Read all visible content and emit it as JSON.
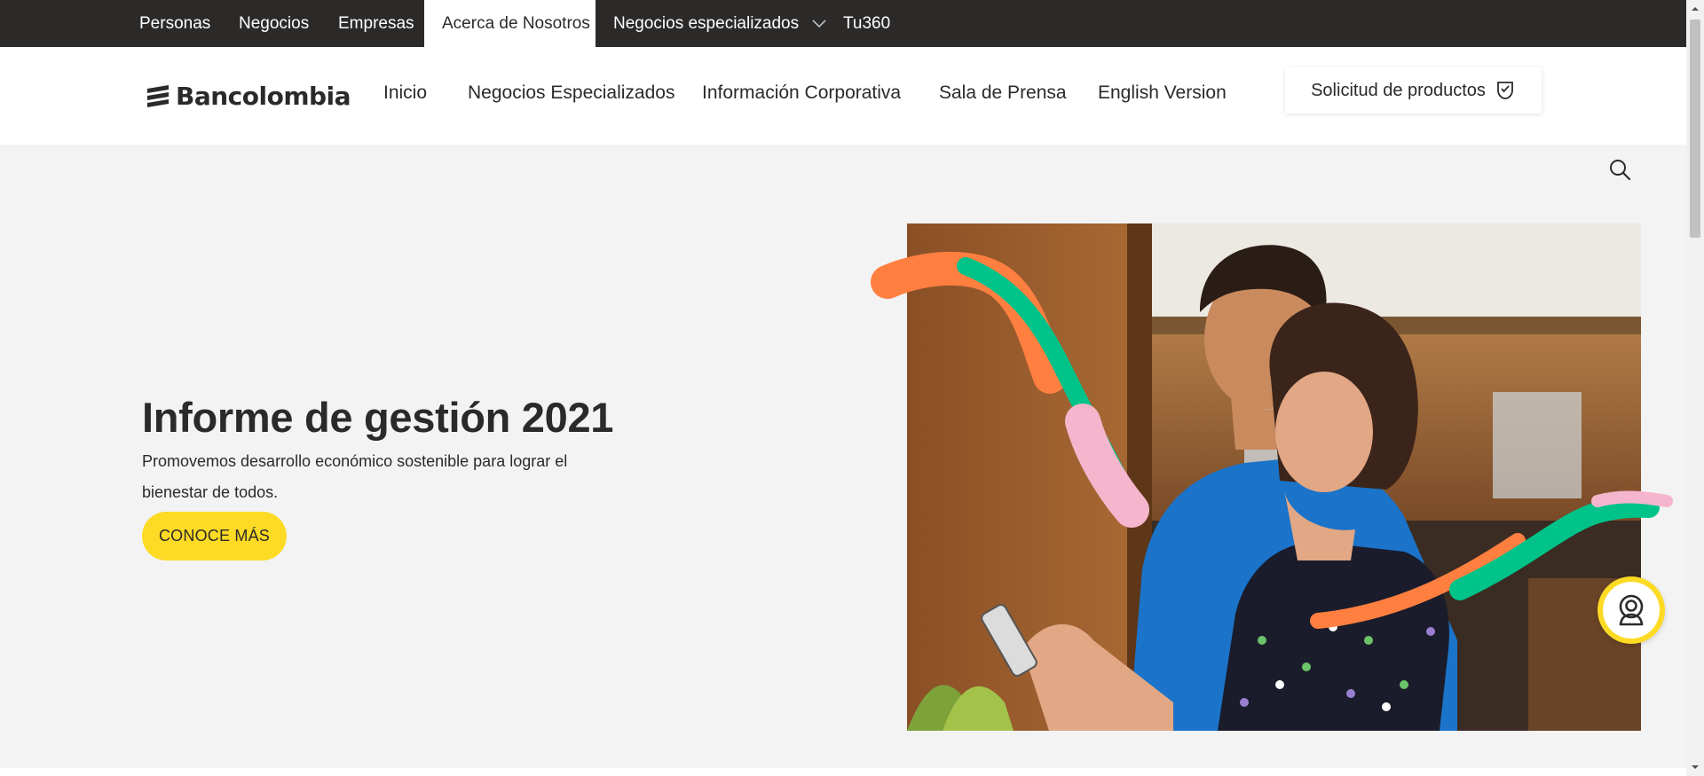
{
  "topbar": {
    "tabs": [
      {
        "label": "Personas"
      },
      {
        "label": "Negocios"
      },
      {
        "label": "Empresas"
      },
      {
        "label": "Acerca de Nosotros",
        "active": true
      },
      {
        "label": "Negocios especializados",
        "has_dropdown": true
      },
      {
        "label": "Tu360"
      }
    ]
  },
  "header": {
    "logo_text": "Bancolombia",
    "nav": [
      {
        "label": "Inicio"
      },
      {
        "label": "Negocios Especializados"
      },
      {
        "label": "Información Corporativa"
      },
      {
        "label": "Sala de Prensa"
      },
      {
        "label": "English Version"
      }
    ],
    "products_button": "Solicitud de productos"
  },
  "hero": {
    "title": "Informe de gestión 2021",
    "subtitle": "Promovemos desarrollo económico sostenible para lograr el bienestar de todos.",
    "cta": "CONOCE MÁS"
  },
  "colors": {
    "dark": "#2c2a29",
    "yellow": "#fdda24",
    "orange": "#ff7f41",
    "green": "#00c389",
    "pink": "#f5b6cd",
    "background": "#f3f3f3"
  },
  "icons": {
    "search": "search-icon",
    "chevron": "chevron-down-icon",
    "products": "product-request-icon",
    "help": "support-agent-icon"
  }
}
